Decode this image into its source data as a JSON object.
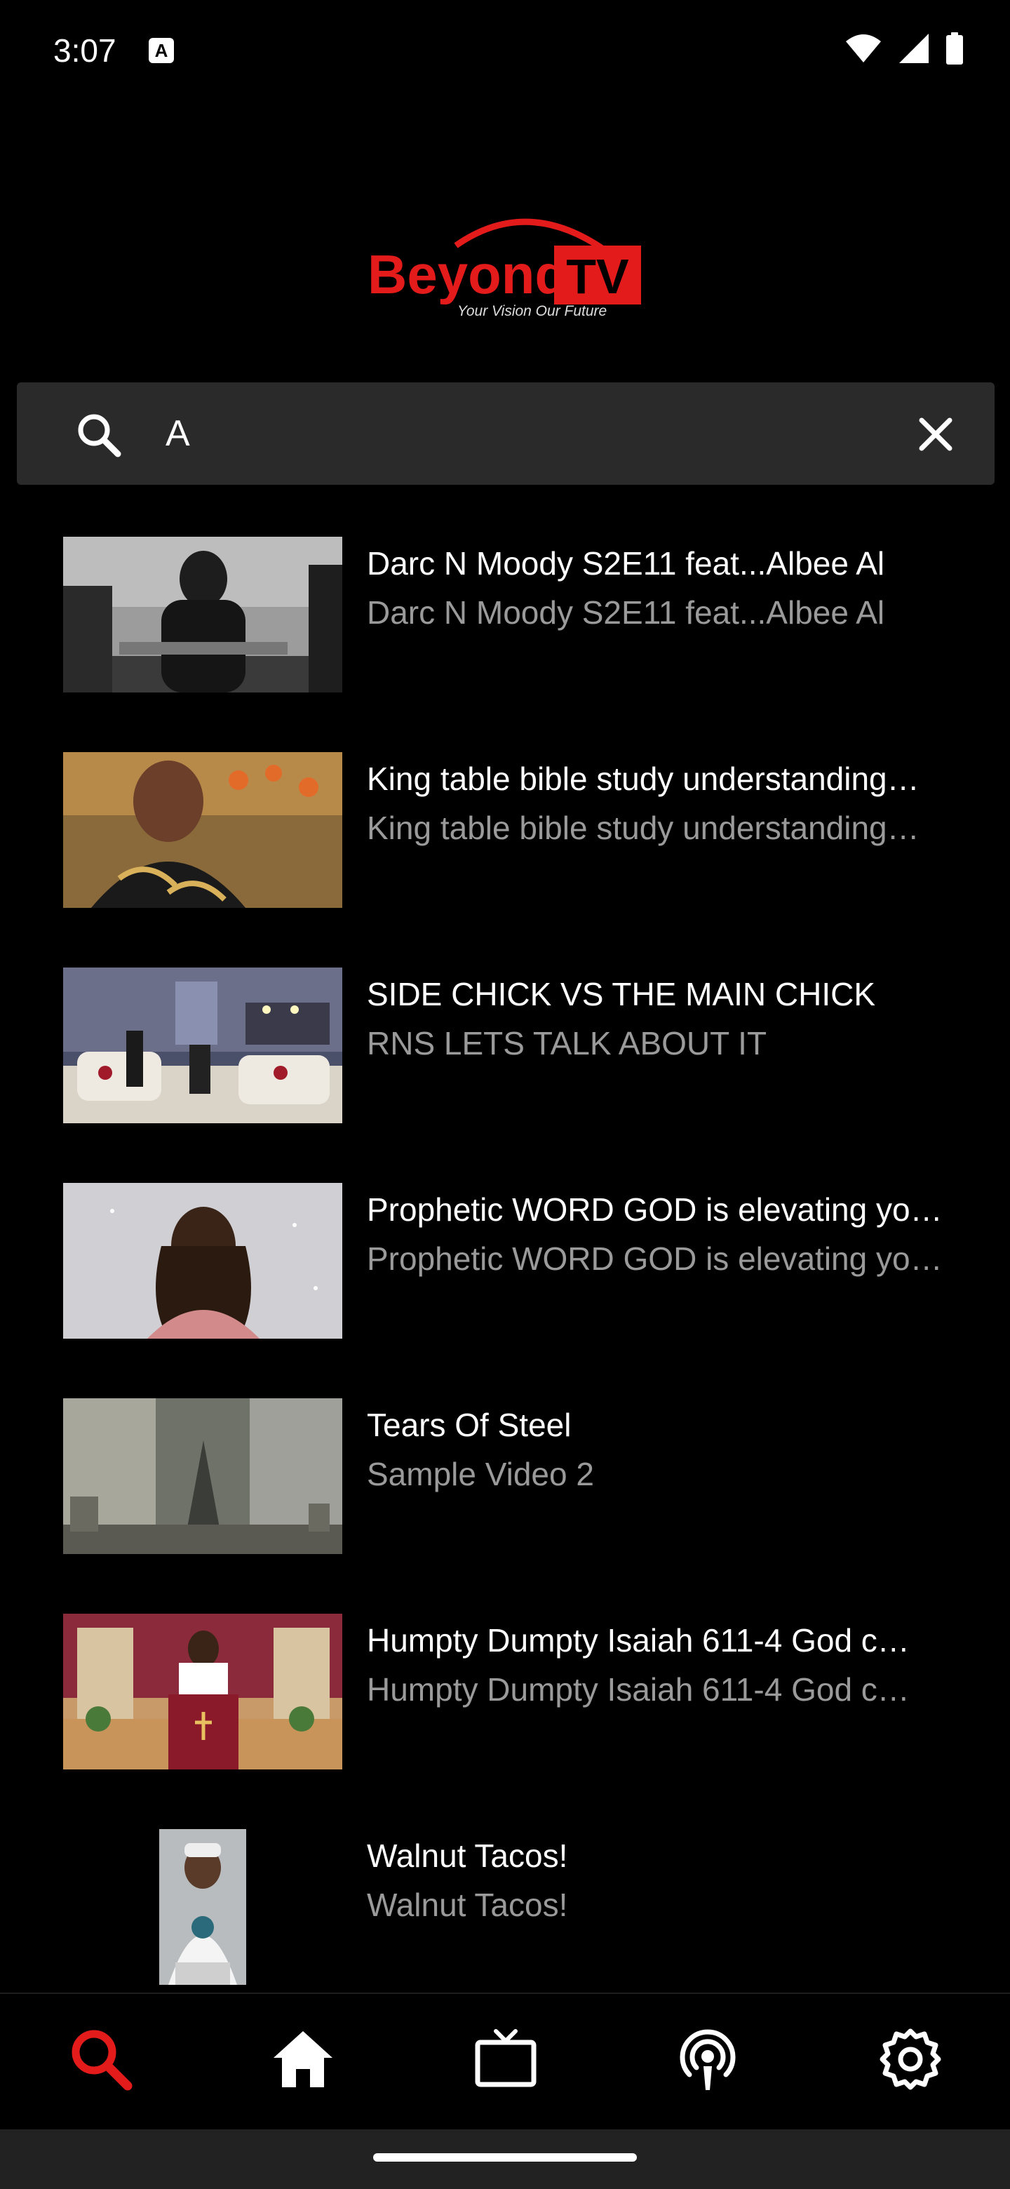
{
  "status_bar": {
    "time": "3:07",
    "notification_glyph": "A",
    "icons": [
      "wifi-icon",
      "signal-icon",
      "battery-icon"
    ]
  },
  "logo": {
    "brand_main": "Beyond",
    "brand_box": "TV",
    "tagline": "Your Vision Our Future",
    "colors": {
      "brand_red": "#e31b1b"
    }
  },
  "search": {
    "value": "A",
    "icon": "search-icon",
    "clear_icon": "close-icon"
  },
  "results": [
    {
      "title": "Darc N Moody S2E11 feat...Albee Al",
      "subtitle": "Darc N Moody S2E11 feat...Albee Al",
      "thumb": "grayscale-podcast"
    },
    {
      "title": "King table bible study understanding…",
      "subtitle": "King table bible study understanding…",
      "thumb": "woman-speaking"
    },
    {
      "title": "SIDE CHICK VS THE MAIN CHICK",
      "subtitle": "RNS LETS TALK ABOUT IT",
      "thumb": "living-room"
    },
    {
      "title": "Prophetic WORD GOD is elevating yo…",
      "subtitle": "Prophetic WORD GOD is elevating yo…",
      "thumb": "woman-sparkle"
    },
    {
      "title": "Tears Of Steel",
      "subtitle": "Sample Video 2",
      "thumb": "tears-of-steel"
    },
    {
      "title": "Humpty Dumpty Isaiah 611-4 God c…",
      "subtitle": "Humpty Dumpty Isaiah 611-4 God c…",
      "thumb": "church-pulpit"
    },
    {
      "title": "Walnut Tacos!",
      "subtitle": "Walnut Tacos!",
      "thumb": "man-portrait"
    }
  ],
  "bottom_nav": {
    "active_color": "#e31b1b",
    "items": [
      "search-icon",
      "home-icon",
      "tv-icon",
      "podcast-icon",
      "settings-icon"
    ],
    "active": "search-icon"
  }
}
